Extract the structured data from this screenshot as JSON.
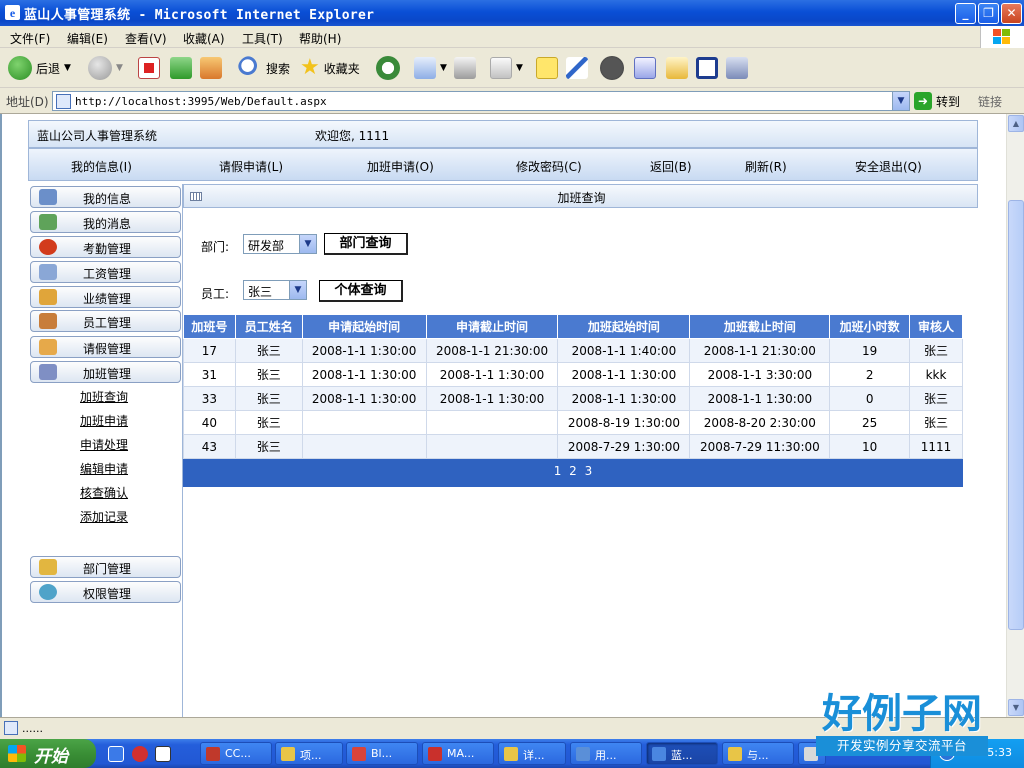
{
  "window": {
    "title": "蓝山人事管理系统 - Microsoft Internet Explorer",
    "min_label": "_",
    "max_label": "❐",
    "close_label": "✕"
  },
  "menubar": {
    "items": [
      "文件(F)",
      "编辑(E)",
      "查看(V)",
      "收藏(A)",
      "工具(T)",
      "帮助(H)"
    ]
  },
  "toolbar": {
    "back_label": "后退",
    "search_label": "搜索",
    "favorites_label": "收藏夹"
  },
  "address": {
    "label": "地址(D)",
    "url": "http://localhost:3995/Web/Default.aspx",
    "go_label": "转到",
    "links_label": "链接"
  },
  "app": {
    "system_name": "蓝山公司人事管理系统",
    "welcome": "欢迎您, 1111",
    "nav": [
      "我的信息(I)",
      "请假申请(L)",
      "加班申请(O)",
      "修改密码(C)",
      "返回(B)",
      "刷新(R)",
      "安全退出(Q)"
    ]
  },
  "sidebar": {
    "items": [
      {
        "label": "我的信息",
        "icon": "user-info-icon",
        "color": "#6b8fc9"
      },
      {
        "label": "我的消息",
        "icon": "messages-icon",
        "color": "#5fa35a"
      },
      {
        "label": "考勤管理",
        "icon": "clock-icon",
        "color": "#d23b1c"
      },
      {
        "label": "工资管理",
        "icon": "salary-icon",
        "color": "#8aa7d6"
      },
      {
        "label": "业绩管理",
        "icon": "performance-box-icon",
        "color": "#e0a53a"
      },
      {
        "label": "员工管理",
        "icon": "employees-icon",
        "color": "#c87d3a"
      },
      {
        "label": "请假管理",
        "icon": "leave-book-icon",
        "color": "#e6a94a"
      },
      {
        "label": "加班管理",
        "icon": "overtime-edit-icon",
        "color": "#7f8fc4"
      }
    ],
    "subitems": [
      "加班查询",
      "加班申请",
      "申请处理",
      "编辑申请",
      "核查确认",
      "添加记录"
    ],
    "bottom_items": [
      {
        "label": "部门管理",
        "icon": "department-icon",
        "color": "#e2b640"
      },
      {
        "label": "权限管理",
        "icon": "permissions-icon",
        "color": "#4fa3c9"
      }
    ]
  },
  "main": {
    "header_title": "加班查询",
    "dept_label": "部门:",
    "dept_value": "研发部",
    "dept_button": "部门查询",
    "emp_label": "员工:",
    "emp_value": "张三",
    "emp_button": "个体查询",
    "columns": [
      "加班号",
      "员工姓名",
      "申请起始时间",
      "申请截止时间",
      "加班起始时间",
      "加班截止时间",
      "加班小时数",
      "审核人"
    ],
    "rows": [
      [
        "17",
        "张三",
        "2008-1-1 1:30:00",
        "2008-1-1 21:30:00",
        "2008-1-1 1:40:00",
        "2008-1-1 21:30:00",
        "19",
        "张三"
      ],
      [
        "31",
        "张三",
        "2008-1-1 1:30:00",
        "2008-1-1 1:30:00",
        "2008-1-1 1:30:00",
        "2008-1-1 3:30:00",
        "2",
        "kkk"
      ],
      [
        "33",
        "张三",
        "2008-1-1 1:30:00",
        "2008-1-1 1:30:00",
        "2008-1-1 1:30:00",
        "2008-1-1 1:30:00",
        "0",
        "张三"
      ],
      [
        "40",
        "张三",
        "",
        "",
        "2008-8-19 1:30:00",
        "2008-8-20 2:30:00",
        "25",
        "张三"
      ],
      [
        "43",
        "张三",
        "",
        "",
        "2008-7-29 1:30:00",
        "2008-7-29 11:30:00",
        "10",
        "1111"
      ]
    ],
    "pager": [
      "1",
      "2",
      "3"
    ]
  },
  "statusbar": {
    "text": "......"
  },
  "taskbar": {
    "start_label": "开始",
    "tasks": [
      {
        "label": "CC...",
        "color": "#c0392b"
      },
      {
        "label": "项...",
        "color": "#e8c547"
      },
      {
        "label": "Bl...",
        "color": "#d9443a"
      },
      {
        "label": "MA...",
        "color": "#c9302c"
      },
      {
        "label": "详...",
        "color": "#e8c547"
      },
      {
        "label": "用...",
        "color": "#5a8fd8"
      },
      {
        "label": "蓝...",
        "color": "#4a86e0"
      },
      {
        "label": "与...",
        "color": "#e8c547"
      },
      {
        "label": "",
        "color": "#d9d9d9"
      }
    ],
    "clock": "5:33"
  },
  "watermark": {
    "big": "好例子网",
    "small": "开发实例分享交流平台"
  }
}
